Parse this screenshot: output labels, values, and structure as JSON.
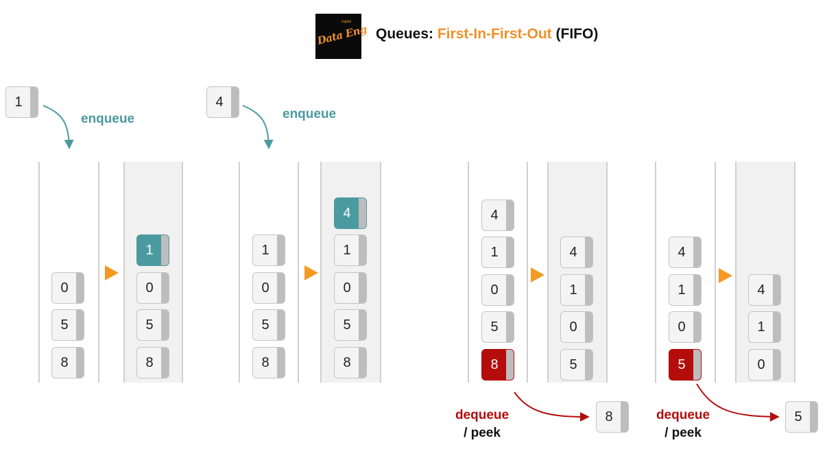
{
  "header": {
    "logo_text": "Data Eng",
    "logo_small": "Digital",
    "title_prefix": "Queues: ",
    "title_accent": "First-In-First-Out",
    "title_suffix": " (FIFO)"
  },
  "colors": {
    "accent_orange": "#f0902a",
    "enqueue_teal": "#4b9aa0",
    "dequeue_red": "#b50c0c",
    "box_fill": "#f4f4f4",
    "box_tab": "#bdbdbd"
  },
  "labels": {
    "enqueue": "enqueue",
    "dequeue": "dequeue",
    "peek": "/ peek"
  },
  "steps": [
    {
      "incoming": "1",
      "before": [
        "0",
        "5",
        "8"
      ],
      "after": [
        "1",
        "0",
        "5",
        "8"
      ]
    },
    {
      "incoming": "4",
      "before": [
        "1",
        "0",
        "5",
        "8"
      ],
      "after": [
        "4",
        "1",
        "0",
        "5",
        "8"
      ]
    },
    {
      "before": [
        "4",
        "1",
        "0",
        "5",
        "8"
      ],
      "after": [
        "4",
        "1",
        "0",
        "5"
      ],
      "outgoing": "8"
    },
    {
      "before": [
        "4",
        "1",
        "0",
        "5"
      ],
      "after": [
        "4",
        "1",
        "0"
      ],
      "outgoing": "5"
    }
  ]
}
